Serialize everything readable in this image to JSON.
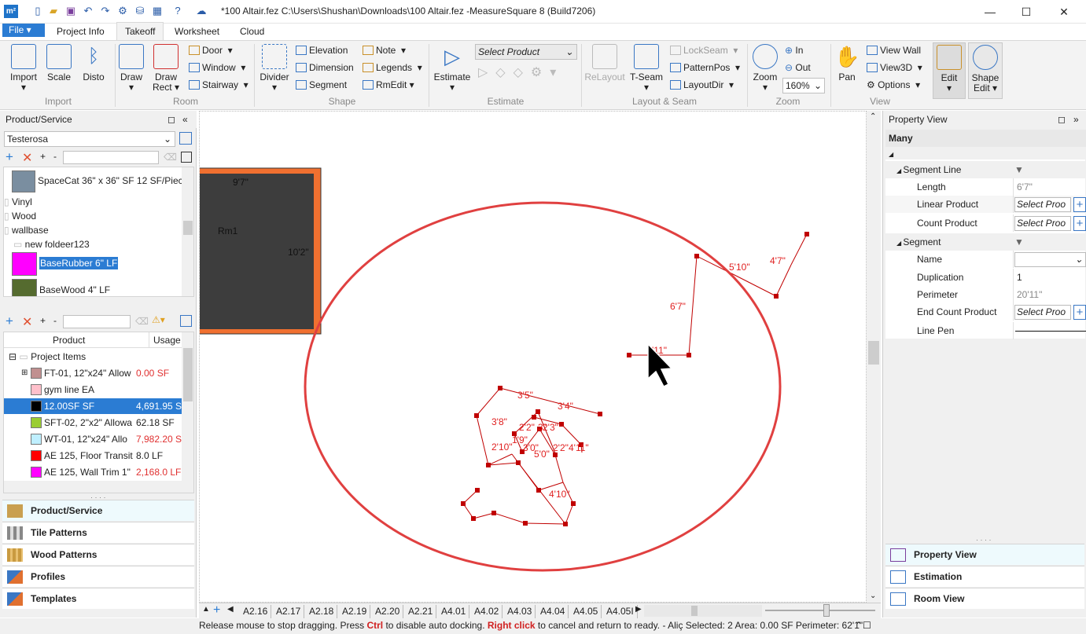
{
  "window": {
    "title": "*100 Altair.fez C:\\Users\\Shushan\\Downloads\\100 Altair.fez -MeasureSquare 8 (Build7206)",
    "app_badge": "m²",
    "minimize": "—",
    "maximize": "☐",
    "close": "✕"
  },
  "ribbon_tabs": {
    "file": "File",
    "items": [
      "Project Info",
      "Takeoff",
      "Worksheet",
      "Cloud"
    ],
    "active": "Takeoff"
  },
  "ribbon": {
    "import": "Import",
    "scale": "Scale",
    "disto": "Disto",
    "draw": "Draw",
    "draw_rect": "Draw Rect",
    "door": "Door",
    "window": "Window",
    "stairway": "Stairway",
    "divider": "Divider",
    "elevation": "Elevation",
    "dimension": "Dimension",
    "segment": "Segment",
    "note": "Note",
    "legends": "Legends",
    "rmedit": "RmEdit",
    "estimate": "Estimate",
    "select_product": "Select Product",
    "relayout": "ReLayout",
    "tseam": "T-Seam",
    "lockseam": "LockSeam",
    "patternpos": "PatternPos",
    "layoutdir": "LayoutDir",
    "zoom": "Zoom",
    "zoom_in": "In",
    "zoom_out": "Out",
    "zoom_value": "160%",
    "pan": "Pan",
    "view_wall": "View Wall",
    "view3d": "View3D",
    "options": "Options",
    "edit": "Edit",
    "shape_edit": "Shape Edit",
    "groups": {
      "import": "Import",
      "room": "Room",
      "shape": "Shape",
      "estimate": "Estimate",
      "layout_seam": "Layout & Seam",
      "zoom": "Zoom",
      "view": "View"
    }
  },
  "product_panel": {
    "header": "Product/Service",
    "category": "Testerosa",
    "items": [
      {
        "label": "SpaceCat 36\" x 36\" SF 12 SF/Piece",
        "color": "#7a8ea0"
      },
      {
        "label": "Vinyl"
      },
      {
        "label": "Wood"
      },
      {
        "label": "wallbase"
      },
      {
        "label": "new foldeer123"
      },
      {
        "label": "BaseRubber 6\" LF",
        "color": "#ff00ff"
      },
      {
        "label": "BaseWood 4\" LF",
        "color": "#556b2f"
      }
    ]
  },
  "project_items": {
    "col_product": "Product",
    "col_usage": "Usage",
    "root": "Project Items",
    "rows": [
      {
        "name": "FT-01, 12\"x24\" Allow",
        "usage": "0.00 SF",
        "color": "#c09090",
        "usage_red": true
      },
      {
        "name": "gym line  EA",
        "usage": "",
        "color": "#ffc0cb",
        "usage_red": false
      },
      {
        "name": "12.00SF  SF",
        "usage": "4,691.95 SF",
        "color": "#000000",
        "usage_red": false
      },
      {
        "name": "SFT-02, 2\"x2\" Allowa",
        "usage": "62.18 SF",
        "color": "#9acd32",
        "usage_red": false
      },
      {
        "name": "WT-01, 12\"x24\" Allo",
        "usage": "7,982.20 SF",
        "color": "#bfefff",
        "usage_red": true
      },
      {
        "name": "AE 125, Floor Transit",
        "usage": "8.0 LF",
        "color": "#ff0000",
        "usage_red": false
      },
      {
        "name": "AE 125, Wall Trim 1\"",
        "usage": "2,168.0 LF",
        "color": "#ff00ff",
        "usage_red": true
      }
    ]
  },
  "nav_left": [
    "Product/Service",
    "Tile Patterns",
    "Wood Patterns",
    "Profiles",
    "Templates"
  ],
  "canvas": {
    "room_name": "Rm1",
    "room_dim_top": "9'7\"",
    "room_dim_right": "10'2\"",
    "dims": [
      "5'10\"",
      "4'7\"",
      "6'7\"",
      "'11\"",
      "3'5\"",
      "3'4\"",
      "3'8\"",
      "2'2\"",
      "3\"",
      "2'3\"",
      "1'9\"",
      "2'10\"",
      "3'0\"",
      "5'0\"",
      "2'2\"",
      "4'11\"",
      "4'10\""
    ]
  },
  "sheet_tabs": [
    "A2.16",
    "A2.17",
    "A2.18",
    "A2.19",
    "A2.20",
    "A2.21",
    "A4.01",
    "A4.02",
    "A4.03",
    "A4.04",
    "A4.05",
    "A4.05I"
  ],
  "status": {
    "part1": "Release mouse to stop dragging. Press ",
    "ctrl": "Ctrl",
    "part2": " to disable auto docking. ",
    "right_click": "Right click",
    "part3": " to cancel and return to ready. - Aliç Selected: 2 Area: 0.00 SF Perimeter: 62'1\""
  },
  "property_view": {
    "header": "Property View",
    "selection": "Many",
    "segment_line": "Segment Line",
    "length_label": "Length",
    "length_value": "6'7\"",
    "linear_product": "Linear Product",
    "select_prod": "Select Proo",
    "count_product": "Count Product",
    "segment": "Segment",
    "name_label": "Name",
    "duplication_label": "Duplication",
    "duplication_value": "1",
    "perimeter_label": "Perimeter",
    "perimeter_value": "20'11\"",
    "end_count_product": "End Count Product",
    "line_pen": "Line Pen"
  },
  "nav_right": [
    "Property View",
    "Estimation",
    "Room View"
  ],
  "colors": {
    "accent": "#2b7cd3",
    "drawing": "#c00000",
    "ellipse": "#e04040",
    "room_border": "#f07030",
    "room_fill": "#3d3d3d"
  }
}
